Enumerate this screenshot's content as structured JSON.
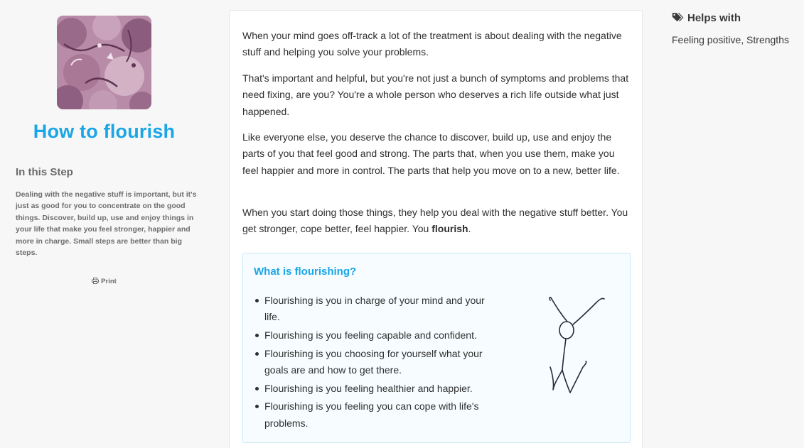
{
  "step": {
    "title": "How to flourish",
    "image_alt": "illustration-of-people",
    "in_this_step": {
      "heading": "In this Step",
      "text": "Dealing with the negative stuff is important, but it's just as good for you to concentrate on the good things. Discover, build up, use and enjoy things in your life that make you feel stronger, happier and more in charge. Small steps are better than big steps."
    },
    "print": {
      "label": "Print",
      "icon": "printer-icon"
    }
  },
  "content": {
    "paragraphs": [
      {
        "text": "When your mind goes off-track a lot of the treatment is about dealing with the negative stuff and helping you solve your problems."
      },
      {
        "text": "That's important and helpful, but you're not just a bunch of symptoms and problems that need fixing, are you? You're a whole person who deserves a rich life outside what just happened."
      },
      {
        "text": "Like everyone else, you deserve the chance to discover, build up, use and enjoy the parts of you that feel good and strong. The parts that, when you use them, make you feel happier and more in control. The parts that help you move on to a new, better life."
      },
      {
        "before": "When you start doing those things, they help you deal with the negative stuff better. You get stronger, cope better, feel happier. You ",
        "bold": "flourish",
        "after": "."
      }
    ],
    "callout": {
      "title": "What is flourishing?",
      "items": [
        "Flourishing is you in charge of your mind and your life.",
        "Flourishing is you feeling capable and confident.",
        "Flourishing is you choosing for yourself what your goals are and how to get there.",
        "Flourishing is you feeling healthier and happier.",
        "Flourishing is you feeling you can cope with life's problems."
      ]
    }
  },
  "helps_with": {
    "heading": "Helps with",
    "icon": "tags-icon",
    "tags": "Feeling positive, Strengths"
  },
  "colors": {
    "accent": "#1aa5e6",
    "callout_bg": "#f6fcff",
    "callout_border": "#c9e8f5",
    "page_bg": "#f7f7f7"
  }
}
